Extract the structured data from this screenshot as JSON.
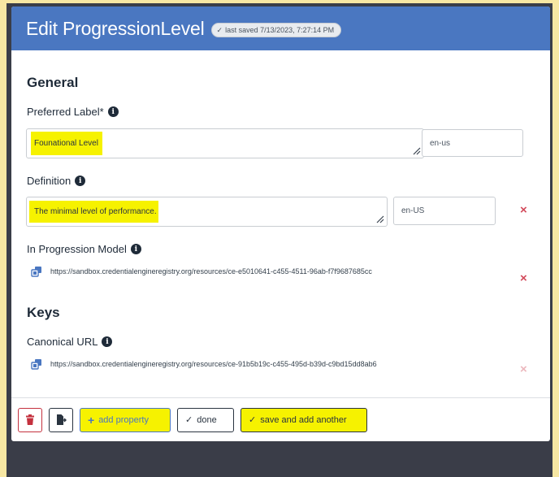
{
  "header": {
    "title": "Edit ProgressionLevel",
    "saved_badge": "last saved 7/13/2023, 7:27:14 PM"
  },
  "general": {
    "heading": "General",
    "preferred_label": {
      "label": "Preferred Label*",
      "value": "Founational Level",
      "lang": "en-us"
    },
    "definition": {
      "label": "Definition",
      "value": "The minimal level of performance.",
      "lang": "en-US"
    },
    "progression_model": {
      "label": "In Progression Model",
      "url": "https://sandbox.credentialengineregistry.org/resources/ce-e5010641-c455-4511-96ab-f7f9687685cc"
    }
  },
  "keys": {
    "heading": "Keys",
    "canonical_url": {
      "label": "Canonical URL",
      "url": "https://sandbox.credentialengineregistry.org/resources/ce-91b5b19c-c455-495d-b39d-c9bd15dd8ab6"
    }
  },
  "footer": {
    "add_property": "add property",
    "done": "done",
    "save_and_add_another": "save and add another"
  },
  "icons": {
    "delete": "trash-icon",
    "export": "file-export-icon",
    "plus": "plus-icon",
    "check": "check-icon",
    "link": "external-link-icon",
    "info": "info-icon",
    "remove": "close-icon"
  },
  "colors": {
    "header": "#4a77c1",
    "danger": "#d2495a",
    "highlight": "#f6f200"
  }
}
